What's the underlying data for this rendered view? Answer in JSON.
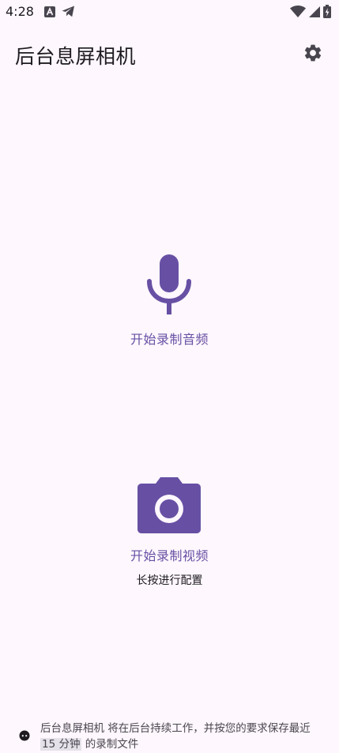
{
  "status_bar": {
    "time": "4:28"
  },
  "app_bar": {
    "title": "后台息屏相机"
  },
  "audio": {
    "label": "开始录制音频"
  },
  "video": {
    "label": "开始录制视频",
    "hint": "长按进行配置"
  },
  "footer": {
    "text_before": "后台息屏相机 将在后台持续工作，并按您的要求保存最近 ",
    "highlight": "15 分钟",
    "text_after": " 的录制文件"
  },
  "colors": {
    "background": "#FEF7FD",
    "accent": "#6750A4",
    "icon_dark": "#49454F",
    "text": "#1D1B20"
  },
  "icons": {
    "settings": "gear-icon",
    "audio": "microphone-icon",
    "video": "camera-icon",
    "footer": "face-icon"
  }
}
